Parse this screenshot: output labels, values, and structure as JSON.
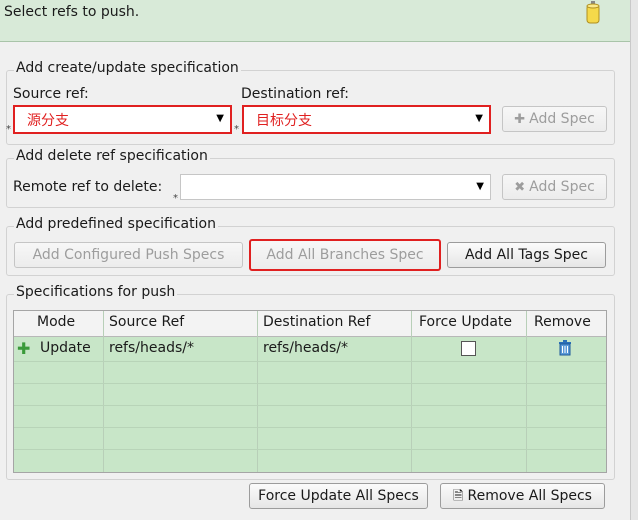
{
  "header": {
    "title": "Select refs to push."
  },
  "create_update": {
    "title": "Add create/update specification",
    "source_label": "Source ref:",
    "source_value": "源分支",
    "destination_label": "Destination ref:",
    "destination_value": "目标分支",
    "add_spec_label": "Add Spec"
  },
  "delete_ref": {
    "title": "Add delete ref specification",
    "remote_label": "Remote ref to delete:",
    "remote_value": "",
    "add_spec_label": "Add Spec"
  },
  "predefined": {
    "title": "Add predefined specification",
    "configured_label": "Add Configured Push Specs",
    "all_branches_label": "Add All Branches Spec",
    "all_tags_label": "Add All Tags Spec"
  },
  "specs": {
    "title": "Specifications for push",
    "columns": [
      "Mode",
      "Source Ref",
      "Destination Ref",
      "Force Update",
      "Remove"
    ],
    "rows": [
      {
        "mode": "Update",
        "source": "refs/heads/*",
        "destination": "refs/heads/*",
        "force_update": false
      }
    ]
  },
  "footer": {
    "force_update_all_label": "Force Update All Specs",
    "remove_all_label": "Remove All Specs"
  },
  "colors": {
    "highlight": "#e02020",
    "table_bg": "#c8e6c8",
    "header_bg": "#d8ead8"
  }
}
